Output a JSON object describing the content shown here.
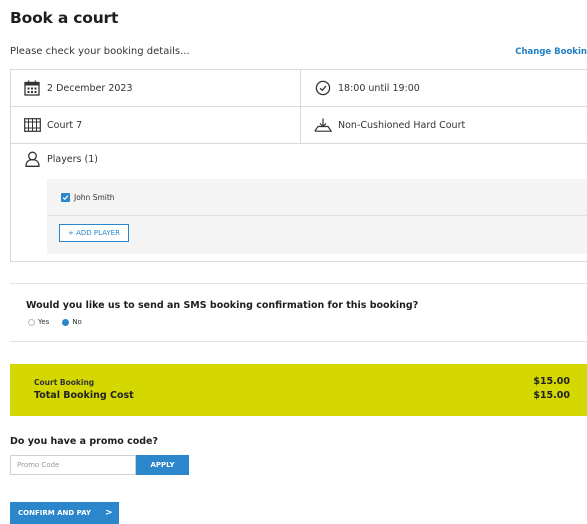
{
  "page": {
    "title": "Book a court",
    "subtitle": "Please check your booking details...",
    "change_link": "Change Booking"
  },
  "details": {
    "date": "2 December 2023",
    "time": "18:00 until 19:00",
    "court": "Court 7",
    "surface": "Non-Cushioned Hard Court"
  },
  "players": {
    "heading": "Players (1)",
    "list": [
      "John Smith"
    ],
    "add_label": "+ ADD PLAYER"
  },
  "sms": {
    "question": "Would you like us to send an SMS booking confirmation for this booking?",
    "options": [
      "Yes",
      "No"
    ],
    "selected": "No"
  },
  "cost": {
    "line_label": "Court Booking",
    "line_value": "$15.00",
    "total_label": "Total Booking Cost",
    "total_value": "$15.00",
    "background": "#d4d700"
  },
  "promo": {
    "question": "Do you have a promo code?",
    "placeholder": "Promo Code",
    "value": "",
    "apply_label": "APPLY"
  },
  "confirm": {
    "label": "CONFIRM AND PAY",
    "chevron": ">"
  },
  "colors": {
    "accent": "#2b86cc",
    "highlight": "#d4d700"
  },
  "icons": {
    "date": "calendar-icon",
    "time": "clock-icon",
    "court": "court-icon",
    "surface": "surface-icon",
    "players": "user-icon"
  }
}
